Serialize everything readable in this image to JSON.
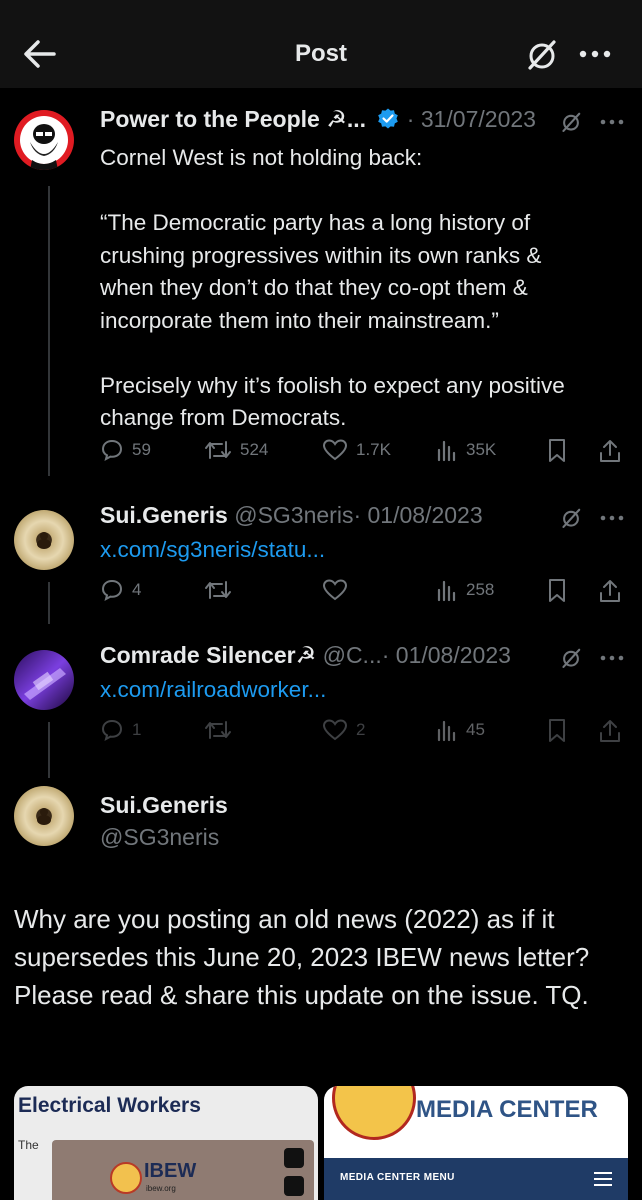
{
  "header": {
    "title": "Post"
  },
  "tweets": [
    {
      "name": "Power to the People ☭...",
      "verified": true,
      "date": "· 31/07/2023",
      "lines": [
        "Cornel West is not holding back:",
        "",
        "“The Democratic party has a long history of",
        "crushing progressives within its own ranks &",
        "when they don’t do that they co-opt them &",
        "incorporate them into their mainstream.”",
        "",
        "Precisely why it’s foolish to expect any positive",
        "change from Democrats."
      ],
      "replies": "59",
      "reposts": "524",
      "likes": "1.7K",
      "views": "35K"
    },
    {
      "name": "Sui.Generis",
      "handle": "@SG3neris",
      "date": "· 01/08/2023",
      "link": "x.com/sg3neris/statu...",
      "replies": "4",
      "reposts": "",
      "likes": "",
      "views": "258"
    },
    {
      "name": "Comrade Silencer☭",
      "handle": "@C...",
      "date": "· 01/08/2023",
      "link": "x.com/railroadworker...",
      "replies": "1",
      "reposts": "",
      "likes": "2",
      "views": "45"
    }
  ],
  "main": {
    "name": "Sui.Generis",
    "handle": "@SG3neris",
    "text": "Why are you posting an old news (2022) as if it supersedes this June 20, 2023 IBEW news letter? Please read & share this update on the issue. TQ."
  },
  "cards": {
    "left_heading": "Electrical Workers",
    "left_sub": "The",
    "left_logo": "IBEW",
    "left_logo_small": "ibew.org",
    "right_heading": "MEDIA CENTER",
    "right_menu": "MEDIA CENTER MENU"
  },
  "colors": {
    "accent": "#1d9bf0",
    "muted": "#71767b",
    "background": "#000000"
  }
}
